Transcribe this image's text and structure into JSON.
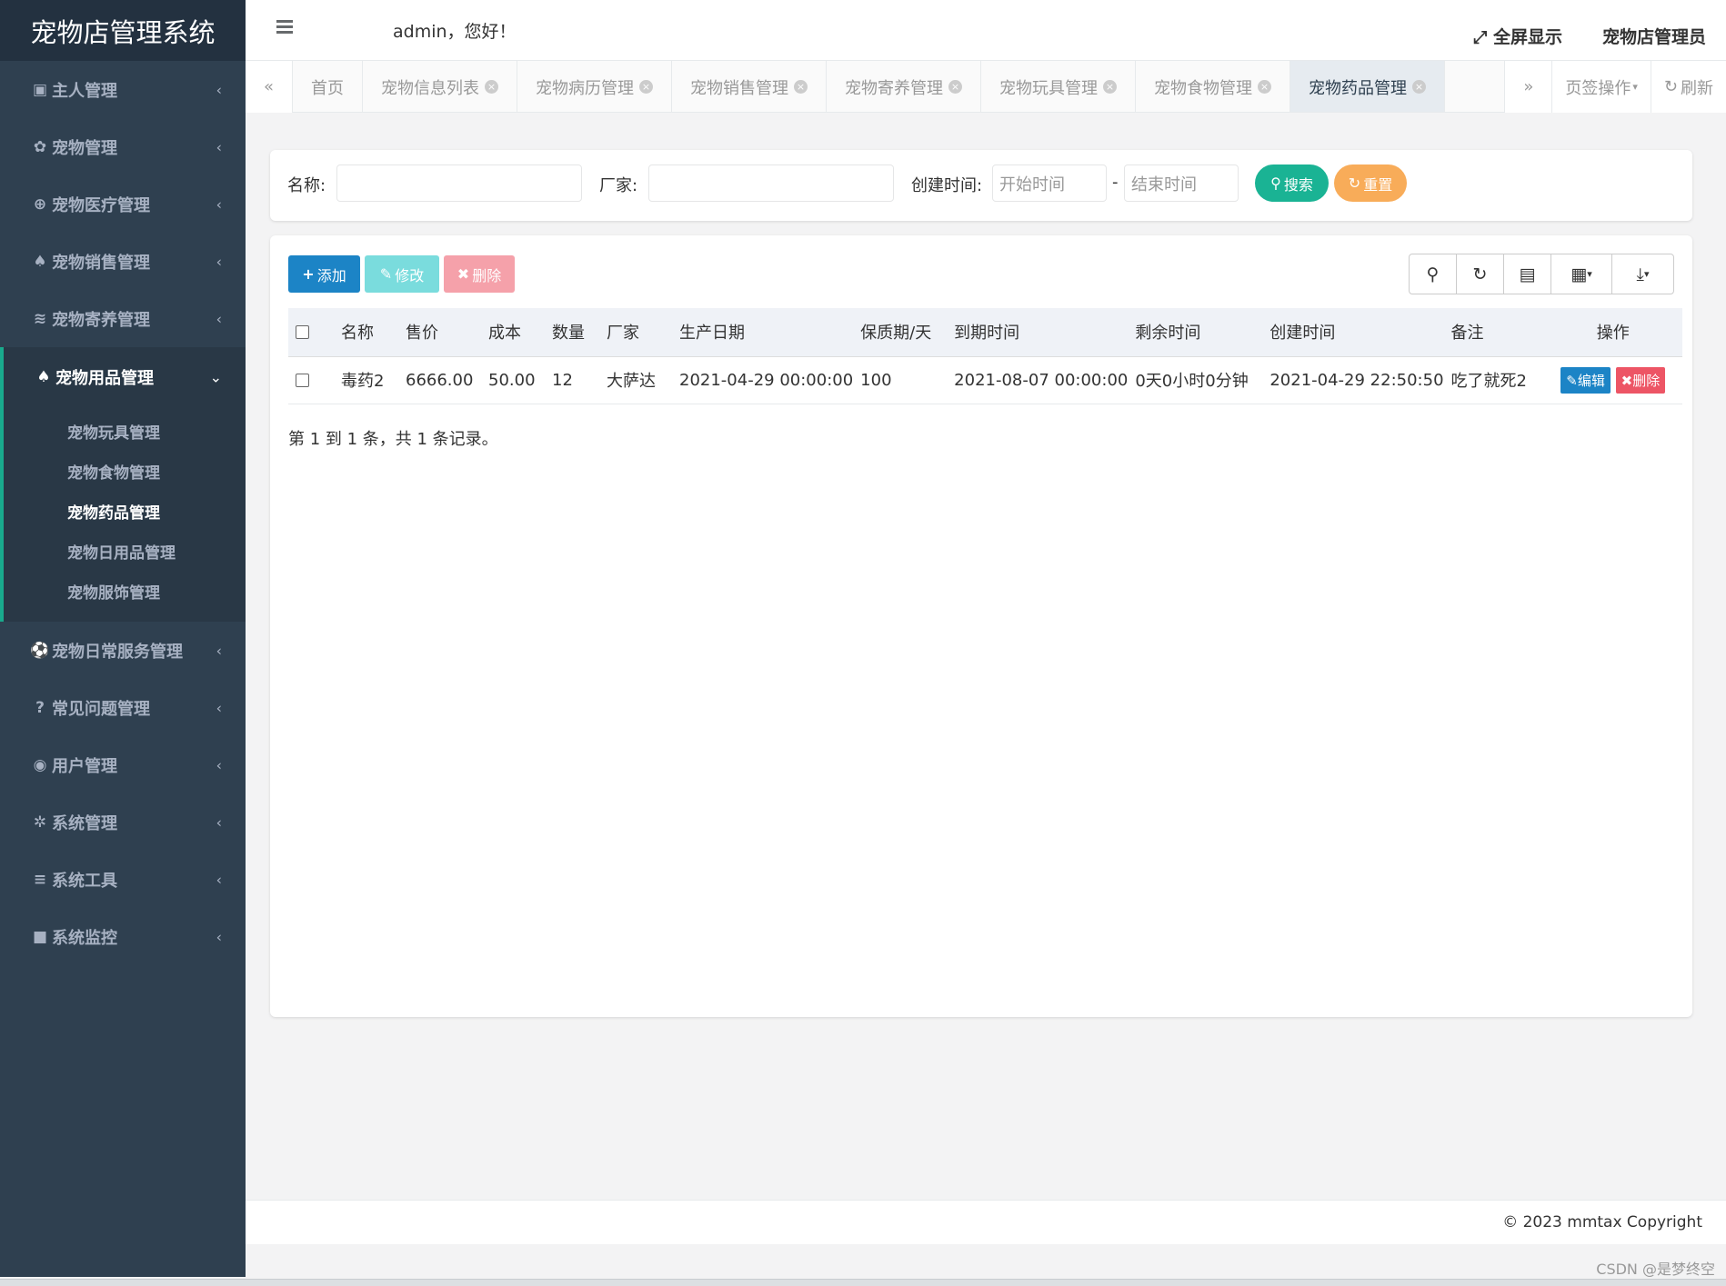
{
  "brand": "宠物店管理系统",
  "header": {
    "greeting": "admin，您好！",
    "fullscreen": "全屏显示",
    "user": "宠物店管理员"
  },
  "sidebar": {
    "items_top": [
      {
        "label": "主人管理",
        "icon": "user-card-icon"
      },
      {
        "label": "宠物管理",
        "icon": "paw-icon"
      },
      {
        "label": "宠物医疗管理",
        "icon": "plus-circle-icon"
      },
      {
        "label": "宠物销售管理",
        "icon": "bell-icon"
      },
      {
        "label": "宠物寄养管理",
        "icon": "wifi-icon"
      }
    ],
    "active": {
      "label": "宠物用品管理",
      "icon": "bell-icon"
    },
    "sub_items": [
      "宠物玩具管理",
      "宠物食物管理",
      "宠物药品管理",
      "宠物日用品管理",
      "宠物服饰管理"
    ],
    "items_bottom": [
      {
        "label": "宠物日常服务管理",
        "icon": "soccer-icon"
      },
      {
        "label": "常见问题管理",
        "icon": "question-icon"
      },
      {
        "label": "用户管理",
        "icon": "user-circle-icon"
      },
      {
        "label": "系统管理",
        "icon": "gear-icon"
      },
      {
        "label": "系统工具",
        "icon": "bars-icon"
      },
      {
        "label": "系统监控",
        "icon": "video-icon"
      }
    ]
  },
  "tabs": [
    "首页",
    "宠物信息列表",
    "宠物病历管理",
    "宠物销售管理",
    "宠物寄养管理",
    "宠物玩具管理",
    "宠物食物管理",
    "宠物药品管理"
  ],
  "tabs_right": {
    "page_ops": "页签操作",
    "refresh": "刷新"
  },
  "search": {
    "name_label": "名称:",
    "vendor_label": "厂家:",
    "created_label": "创建时间:",
    "start_placeholder": "开始时间",
    "end_placeholder": "结束时间",
    "dash": "-",
    "search_btn": "搜索",
    "reset_btn": "重置"
  },
  "toolbar": {
    "add": "添加",
    "edit": "修改",
    "delete": "删除"
  },
  "table": {
    "headers": [
      "名称",
      "售价",
      "成本",
      "数量",
      "厂家",
      "生产日期",
      "保质期/天",
      "到期时间",
      "剩余时间",
      "创建时间",
      "备注",
      "操作"
    ],
    "rows": [
      {
        "name": "毒药2",
        "price": "6666.00",
        "cost": "50.00",
        "qty": "12",
        "vendor": "大萨达",
        "prod_date": "2021-04-29 00:00:00",
        "shelf": "100",
        "expire": "2021-08-07 00:00:00",
        "remain": "0天0小时0分钟",
        "created": "2021-04-29 22:50:50",
        "note": "吃了就死2",
        "edit": "编辑",
        "del": "删除"
      }
    ],
    "pager": "第 1 到 1 条，共 1 条记录。"
  },
  "footer": {
    "copyright": "© 2023 mmtax Copyright"
  },
  "watermark": "CSDN @是梦终空",
  "colors": {
    "sidebar": "#2f4050",
    "primary": "#1c84c6",
    "success": "#1ab394",
    "warning": "#f8ac59",
    "danger": "#ed5565",
    "info": "#23c6c8"
  }
}
